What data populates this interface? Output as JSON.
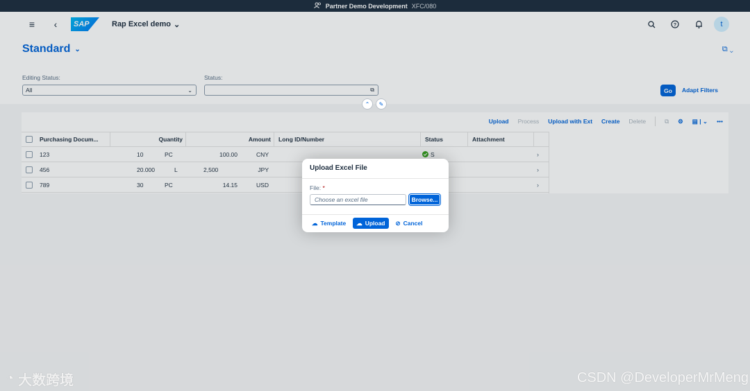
{
  "system_bar": {
    "system": "Partner Demo Development",
    "client": "XFC/080"
  },
  "shell": {
    "app_title": "Rap Excel demo",
    "logo_text": "SAP",
    "avatar_initial": "t"
  },
  "header": {
    "variant": "Standard"
  },
  "filters": {
    "editing_status_label": "Editing Status:",
    "editing_status_value": "All",
    "status_label": "Status:",
    "status_value": "",
    "go": "Go",
    "adapt": "Adapt Filters"
  },
  "toolbar": {
    "upload": "Upload",
    "process": "Process",
    "upload_ext": "Upload with Ext",
    "create": "Create",
    "delete": "Delete"
  },
  "table": {
    "headers": [
      "Purchasing Docum...",
      "Quantity",
      "Amount",
      "Long ID/Number",
      "Status",
      "Attachment"
    ],
    "rows": [
      {
        "doc": "123",
        "qty": "10",
        "unit": "PC",
        "amount": "100.00",
        "currency": "CNY",
        "status": "S"
      },
      {
        "doc": "456",
        "qty": "20.000",
        "unit": "L",
        "amount": "2,500",
        "currency": "JPY",
        "status": ""
      },
      {
        "doc": "789",
        "qty": "30",
        "unit": "PC",
        "amount": "14.15",
        "currency": "USD",
        "status": ""
      }
    ]
  },
  "dialog": {
    "title": "Upload Excel File",
    "file_label": "File:",
    "required_mark": "*",
    "placeholder": "Choose an excel file",
    "browse": "Browse...",
    "template": "Template",
    "upload": "Upload",
    "cancel": "Cancel"
  },
  "watermarks": {
    "left": "大数跨境",
    "right": "CSDN @DeveloperMrMeng"
  },
  "colors": {
    "brand": "#0064d9",
    "success": "#36a41d",
    "shell_dark": "#1d2d3e"
  }
}
